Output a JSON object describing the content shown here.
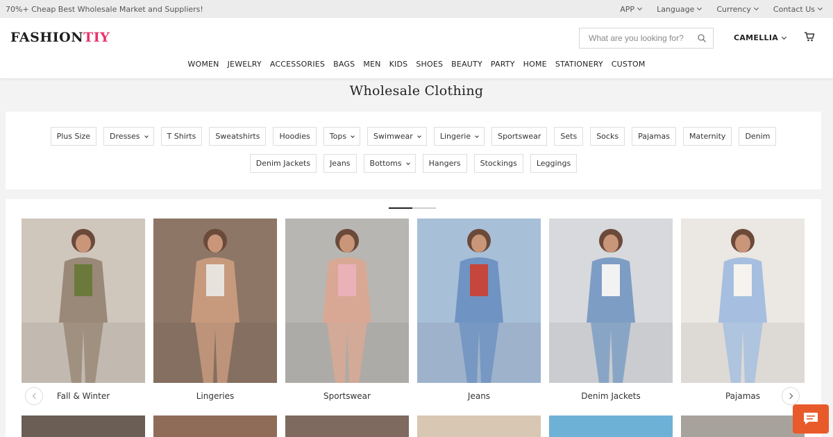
{
  "topbar": {
    "tagline": "70%+ Cheap Best Wholesale Market and Suppliers!",
    "links": [
      "APP",
      "Language",
      "Currency",
      "Contact Us"
    ]
  },
  "header": {
    "logo_main": "FASHION",
    "logo_accent": "TIY",
    "search_placeholder": "What are you looking for?",
    "user_name": "CAMELLIA"
  },
  "nav": [
    "WOMEN",
    "JEWELRY",
    "ACCESSORIES",
    "BAGS",
    "MEN",
    "KIDS",
    "SHOES",
    "BEAUTY",
    "PARTY",
    "HOME",
    "STATIONERY",
    "CUSTOM"
  ],
  "page_title": "Wholesale Clothing",
  "filters": {
    "row1": [
      {
        "label": "Plus Size",
        "dropdown": false
      },
      {
        "label": "Dresses",
        "dropdown": true
      },
      {
        "label": "T Shirts",
        "dropdown": false
      },
      {
        "label": "Sweatshirts",
        "dropdown": false
      },
      {
        "label": "Hoodies",
        "dropdown": false
      },
      {
        "label": "Tops",
        "dropdown": true
      },
      {
        "label": "Swimwear",
        "dropdown": true
      },
      {
        "label": "Lingerie",
        "dropdown": true
      },
      {
        "label": "Sportswear",
        "dropdown": false
      },
      {
        "label": "Sets",
        "dropdown": false
      },
      {
        "label": "Socks",
        "dropdown": false
      },
      {
        "label": "Pajamas",
        "dropdown": false
      },
      {
        "label": "Maternity",
        "dropdown": false
      },
      {
        "label": "Denim",
        "dropdown": false
      }
    ],
    "row2": [
      {
        "label": "Denim Jackets",
        "dropdown": false
      },
      {
        "label": "Jeans",
        "dropdown": false
      },
      {
        "label": "Bottoms",
        "dropdown": true
      },
      {
        "label": "Hangers",
        "dropdown": false
      },
      {
        "label": "Stockings",
        "dropdown": false
      },
      {
        "label": "Leggings",
        "dropdown": false
      }
    ]
  },
  "carousel": {
    "active_page": 1,
    "page_count": 2,
    "cards": [
      {
        "label": "Fall & Winter",
        "bg": "#cfc6bc",
        "figure": "#9a8878",
        "accent": "#6b7a3a"
      },
      {
        "label": "Lingeries",
        "bg": "#8d7666",
        "figure": "#c79a7e",
        "accent": "#e8e2dc"
      },
      {
        "label": "Sportswear",
        "bg": "#b7b6b2",
        "figure": "#d9a894",
        "accent": "#eab1b9"
      },
      {
        "label": "Jeans",
        "bg": "#a8bfd8",
        "figure": "#6f93c2",
        "accent": "#c5463c"
      },
      {
        "label": "Denim Jackets",
        "bg": "#d7d9dc",
        "figure": "#7e9dc4",
        "accent": "#f2f2f2"
      },
      {
        "label": "Pajamas",
        "bg": "#ebe7e2",
        "figure": "#a6bfe0",
        "accent": "#f6f3ef"
      }
    ],
    "row2_colors": [
      "#6a5e55",
      "#8f6c58",
      "#7e6a5e",
      "#d8c7b2",
      "#6eb1d6",
      "#a8a29c"
    ]
  },
  "colors": {
    "brand_accent": "#e8336b",
    "chat_button": "#e95a2b"
  }
}
